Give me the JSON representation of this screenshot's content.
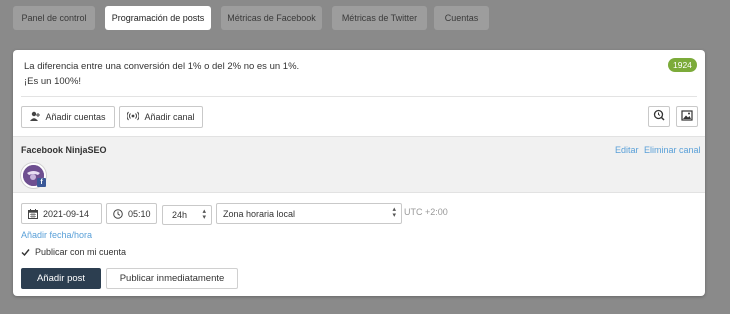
{
  "tabs": [
    {
      "label": "Panel de control",
      "active": false
    },
    {
      "label": "Programación de posts",
      "active": true
    },
    {
      "label": "Métricas de Facebook",
      "active": false
    },
    {
      "label": "Métricas de Twitter",
      "active": false
    },
    {
      "label": "Cuentas",
      "active": false
    }
  ],
  "composer": {
    "message_line1": "La diferencia entre una conversión del 1% o del 2% no es un 1%.",
    "message_line2": "¡Es un 100%!",
    "char_counter": "1924"
  },
  "toolbar": {
    "add_accounts_label": "Añadir cuentas",
    "add_channel_label": "Añadir canal"
  },
  "channel": {
    "name": "Facebook NinjaSEO",
    "edit_label": "Editar",
    "remove_label": "Eliminar canal"
  },
  "schedule": {
    "date": "2021-09-14",
    "time": "05:10",
    "format": "24h",
    "timezone": "Zona horaria local",
    "utc_offset": "UTC +2:00",
    "add_datetime_label": "Añadir fecha/hora"
  },
  "options": {
    "publish_with_account_label": "Publicar con mi cuenta",
    "publish_with_account_checked": true
  },
  "actions": {
    "add_post_label": "Añadir post",
    "publish_now_label": "Publicar inmediatamente"
  },
  "colors": {
    "primary_button": "#2c3e50",
    "link": "#5aa0d8",
    "counter_badge": "#7cab3a"
  }
}
